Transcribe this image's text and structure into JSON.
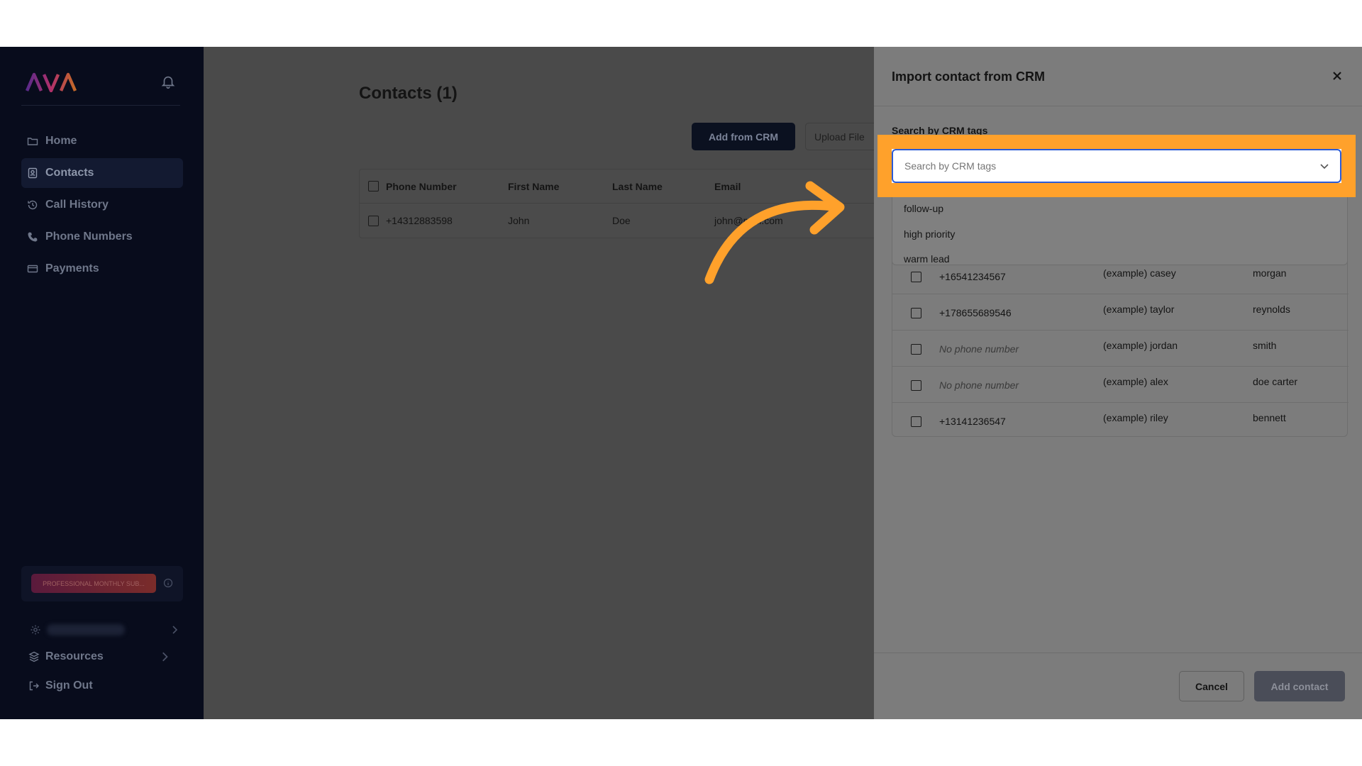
{
  "sidebar": {
    "logo_text": "AVA",
    "nav": [
      {
        "label": "Home",
        "icon": "folder-icon"
      },
      {
        "label": "Contacts",
        "icon": "contacts-icon",
        "active": true
      },
      {
        "label": "Call History",
        "icon": "history-icon"
      },
      {
        "label": "Phone Numbers",
        "icon": "phone-icon"
      },
      {
        "label": "Payments",
        "icon": "card-icon"
      }
    ],
    "plan_badge": "PROFESSIONAL MONTHLY SUB...",
    "resources_label": "Resources",
    "sign_out_label": "Sign Out"
  },
  "main": {
    "title": "Contacts (1)",
    "add_from_crm_label": "Add from CRM",
    "upload_file_label": "Upload File",
    "table": {
      "headers": [
        "Phone Number",
        "First Name",
        "Last Name",
        "Email"
      ],
      "rows": [
        {
          "phone": "+14312883598",
          "first": "John",
          "last": "Doe",
          "email": "john@mail.com"
        }
      ]
    }
  },
  "drawer": {
    "title": "Import contact from CRM",
    "search_label": "Search by CRM tags",
    "search_placeholder": "Search by CRM tags",
    "tag_options": [
      "follow-up",
      "high priority",
      "warm lead"
    ],
    "contacts": [
      {
        "phone": "+16541234567",
        "first": "(example) casey",
        "last": "morgan",
        "has_phone": true
      },
      {
        "phone": "+178655689546",
        "first": "(example) taylor",
        "last": "reynolds",
        "has_phone": true
      },
      {
        "phone": "No phone number",
        "first": "(example) jordan",
        "last": "smith",
        "has_phone": false
      },
      {
        "phone": "No phone number",
        "first": "(example) alex",
        "last": "doe carter",
        "has_phone": false
      },
      {
        "phone": "+13141236547",
        "first": "(example) riley",
        "last": "bennett",
        "has_phone": true
      }
    ],
    "cancel_label": "Cancel",
    "add_contact_label": "Add contact"
  },
  "colors": {
    "highlight": "#ffa12b",
    "sidebar_bg": "#080c1c",
    "overlay": "#4a4a4a",
    "focus_border": "#2a5bd7"
  }
}
